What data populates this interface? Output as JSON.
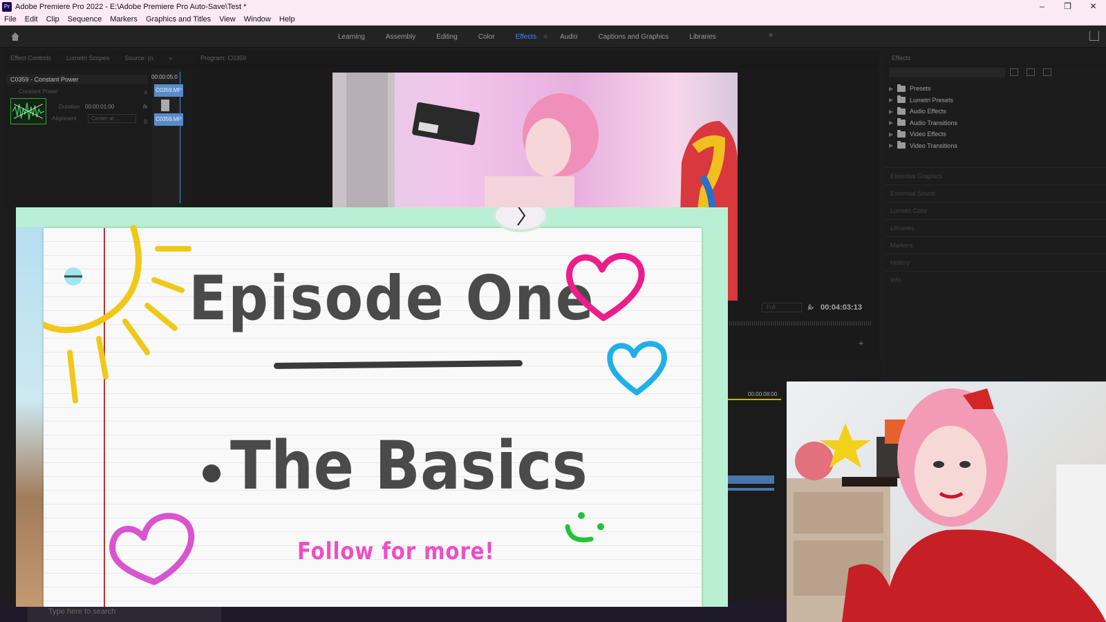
{
  "titlebar": {
    "title": "Adobe Premiere Pro 2022 - E:\\Adobe Premiere Pro Auto-Save\\Test *",
    "logo": "Pr",
    "minimize": "–",
    "restore": "❐",
    "close": "✕"
  },
  "menu": [
    "File",
    "Edit",
    "Clip",
    "Sequence",
    "Markers",
    "Graphics and Titles",
    "View",
    "Window",
    "Help"
  ],
  "workspaces": [
    "Learning",
    "Assembly",
    "Editing",
    "Color",
    "Effects",
    "Audio",
    "Captions and Graphics",
    "Libraries"
  ],
  "active_workspace": "Effects",
  "workspace_more": "»",
  "left_panel": {
    "tabs": [
      "Effect Controls",
      "Lumetri Scopes",
      "Source: (n"
    ],
    "more": "»",
    "clip_header": "C0359 - Constant Power",
    "effect_name": "Constant Power",
    "duration_label": "Duration",
    "duration_value": "00:00:01:00",
    "alignment_label": "Alignment",
    "alignment_value": "Center at ...",
    "timecode": "00:00:05:0",
    "clip_a": "C0359.MP",
    "clip_b": "C0359.MP",
    "track_a": "A",
    "track_b": "B",
    "fx_label": "fx"
  },
  "program": {
    "tab": "Program: C0359",
    "fit": "Full",
    "timecode": "00:04:03:13",
    "add": "+"
  },
  "effects": {
    "tab": "Effects",
    "folders": [
      "Presets",
      "Lumetri Presets",
      "Audio Effects",
      "Audio Transitions",
      "Video Effects",
      "Video Transitions"
    ],
    "sections": [
      "Essential Graphics",
      "Essential Sound",
      "Lumetri Color",
      "Libraries",
      "Markers",
      "History",
      "Info"
    ]
  },
  "timeline": {
    "time": "00:00:08:00"
  },
  "taskbar": {
    "search_placeholder": "Type here to search"
  },
  "overlay": {
    "title": "Episode One",
    "subtitle": "The Basics",
    "cta": "Follow for more!"
  },
  "colors": {
    "accent": "#3b8df0",
    "heart_pink": "#ec1e8c",
    "heart_blue": "#1fb0e6",
    "heart_violet": "#d855cf",
    "sun": "#f0c818",
    "smile": "#22c33a"
  }
}
